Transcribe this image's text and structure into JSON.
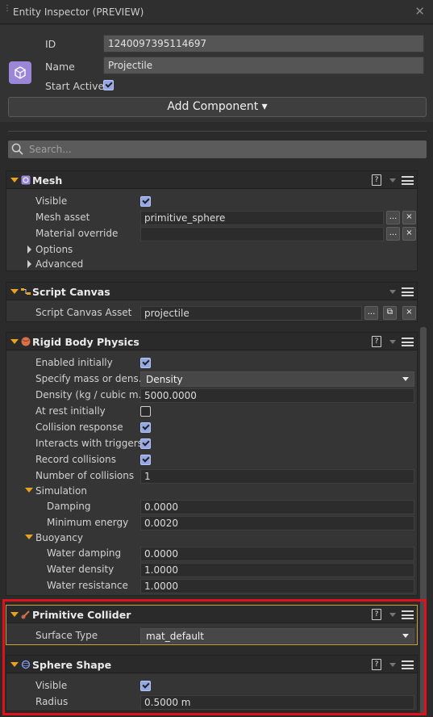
{
  "window": {
    "title": "Entity Inspector (PREVIEW)"
  },
  "entity": {
    "id_label": "ID",
    "id_value": "1240097395114697",
    "name_label": "Name",
    "name_value": "Projectile",
    "start_active_label": "Start Active",
    "start_active": true
  },
  "toolbar": {
    "add_component_label": "Add Component ▾"
  },
  "search": {
    "placeholder": "Search..."
  },
  "mesh": {
    "title": "Mesh",
    "visible_label": "Visible",
    "mesh_asset_label": "Mesh asset",
    "mesh_asset_value": "primitive_sphere",
    "material_override_label": "Material override",
    "material_override_value": "",
    "options_label": "Options",
    "advanced_label": "Advanced",
    "browse_label": "...",
    "clear_label": "×"
  },
  "script_canvas": {
    "title": "Script Canvas",
    "asset_label": "Script Canvas Asset",
    "asset_value": "projectile",
    "browse_label": "...",
    "open_label": "⧉",
    "clear_label": "×"
  },
  "rigid_body": {
    "title": "Rigid Body Physics",
    "enabled_initially_label": "Enabled initially",
    "specify_mass_label": "Specify mass or dens...",
    "specify_mass_value": "Density",
    "density_label": "Density (kg / cubic m...",
    "density_value": "5000.0000",
    "at_rest_label": "At rest initially",
    "collision_response_label": "Collision response",
    "interacts_triggers_label": "Interacts with triggers",
    "record_collisions_label": "Record collisions",
    "num_collisions_label": "Number of collisions",
    "num_collisions_value": "1",
    "simulation_label": "Simulation",
    "damping_label": "Damping",
    "damping_value": "0.0000",
    "min_energy_label": "Minimum energy",
    "min_energy_value": "0.0020",
    "buoyancy_label": "Buoyancy",
    "water_damping_label": "Water damping",
    "water_damping_value": "0.0000",
    "water_density_label": "Water density",
    "water_density_value": "1.0000",
    "water_resistance_label": "Water resistance",
    "water_resistance_value": "1.0000"
  },
  "primitive_collider": {
    "title": "Primitive Collider",
    "surface_type_label": "Surface Type",
    "surface_type_value": "mat_default"
  },
  "sphere_shape": {
    "title": "Sphere Shape",
    "visible_label": "Visible",
    "radius_label": "Radius",
    "radius_value": "0.5000 m"
  },
  "icons": {
    "help": "?",
    "entity": "entity-icon",
    "search": "search-icon"
  },
  "colors": {
    "accent_orange": "#e7a31f",
    "highlight_red": "#e0111b",
    "checkbox_on": "#94a6e5"
  }
}
